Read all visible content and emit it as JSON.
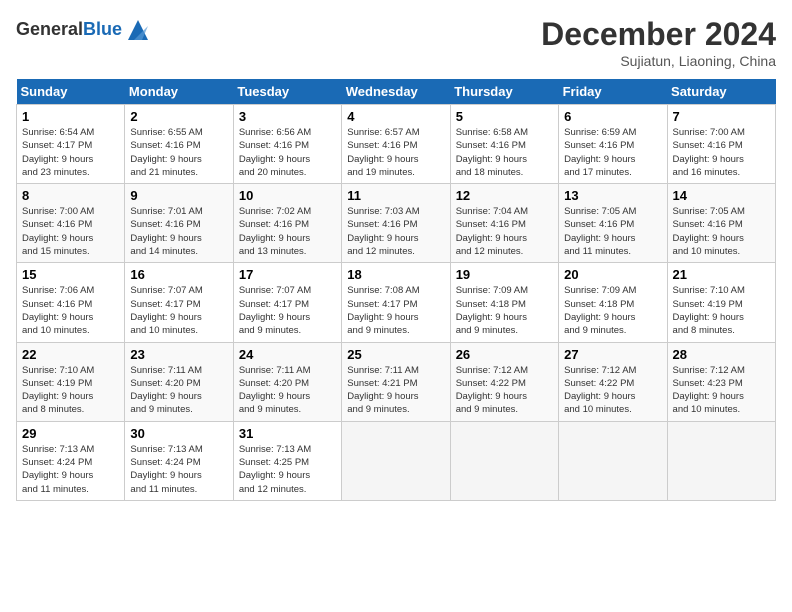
{
  "header": {
    "logo_line1": "General",
    "logo_line2": "Blue",
    "month_title": "December 2024",
    "subtitle": "Sujiatun, Liaoning, China"
  },
  "days_of_week": [
    "Sunday",
    "Monday",
    "Tuesday",
    "Wednesday",
    "Thursday",
    "Friday",
    "Saturday"
  ],
  "weeks": [
    [
      {
        "day": "1",
        "info": "Sunrise: 6:54 AM\nSunset: 4:17 PM\nDaylight: 9 hours\nand 23 minutes."
      },
      {
        "day": "2",
        "info": "Sunrise: 6:55 AM\nSunset: 4:16 PM\nDaylight: 9 hours\nand 21 minutes."
      },
      {
        "day": "3",
        "info": "Sunrise: 6:56 AM\nSunset: 4:16 PM\nDaylight: 9 hours\nand 20 minutes."
      },
      {
        "day": "4",
        "info": "Sunrise: 6:57 AM\nSunset: 4:16 PM\nDaylight: 9 hours\nand 19 minutes."
      },
      {
        "day": "5",
        "info": "Sunrise: 6:58 AM\nSunset: 4:16 PM\nDaylight: 9 hours\nand 18 minutes."
      },
      {
        "day": "6",
        "info": "Sunrise: 6:59 AM\nSunset: 4:16 PM\nDaylight: 9 hours\nand 17 minutes."
      },
      {
        "day": "7",
        "info": "Sunrise: 7:00 AM\nSunset: 4:16 PM\nDaylight: 9 hours\nand 16 minutes."
      }
    ],
    [
      {
        "day": "8",
        "info": "Sunrise: 7:00 AM\nSunset: 4:16 PM\nDaylight: 9 hours\nand 15 minutes."
      },
      {
        "day": "9",
        "info": "Sunrise: 7:01 AM\nSunset: 4:16 PM\nDaylight: 9 hours\nand 14 minutes."
      },
      {
        "day": "10",
        "info": "Sunrise: 7:02 AM\nSunset: 4:16 PM\nDaylight: 9 hours\nand 13 minutes."
      },
      {
        "day": "11",
        "info": "Sunrise: 7:03 AM\nSunset: 4:16 PM\nDaylight: 9 hours\nand 12 minutes."
      },
      {
        "day": "12",
        "info": "Sunrise: 7:04 AM\nSunset: 4:16 PM\nDaylight: 9 hours\nand 12 minutes."
      },
      {
        "day": "13",
        "info": "Sunrise: 7:05 AM\nSunset: 4:16 PM\nDaylight: 9 hours\nand 11 minutes."
      },
      {
        "day": "14",
        "info": "Sunrise: 7:05 AM\nSunset: 4:16 PM\nDaylight: 9 hours\nand 10 minutes."
      }
    ],
    [
      {
        "day": "15",
        "info": "Sunrise: 7:06 AM\nSunset: 4:16 PM\nDaylight: 9 hours\nand 10 minutes."
      },
      {
        "day": "16",
        "info": "Sunrise: 7:07 AM\nSunset: 4:17 PM\nDaylight: 9 hours\nand 10 minutes."
      },
      {
        "day": "17",
        "info": "Sunrise: 7:07 AM\nSunset: 4:17 PM\nDaylight: 9 hours\nand 9 minutes."
      },
      {
        "day": "18",
        "info": "Sunrise: 7:08 AM\nSunset: 4:17 PM\nDaylight: 9 hours\nand 9 minutes."
      },
      {
        "day": "19",
        "info": "Sunrise: 7:09 AM\nSunset: 4:18 PM\nDaylight: 9 hours\nand 9 minutes."
      },
      {
        "day": "20",
        "info": "Sunrise: 7:09 AM\nSunset: 4:18 PM\nDaylight: 9 hours\nand 9 minutes."
      },
      {
        "day": "21",
        "info": "Sunrise: 7:10 AM\nSunset: 4:19 PM\nDaylight: 9 hours\nand 8 minutes."
      }
    ],
    [
      {
        "day": "22",
        "info": "Sunrise: 7:10 AM\nSunset: 4:19 PM\nDaylight: 9 hours\nand 8 minutes."
      },
      {
        "day": "23",
        "info": "Sunrise: 7:11 AM\nSunset: 4:20 PM\nDaylight: 9 hours\nand 9 minutes."
      },
      {
        "day": "24",
        "info": "Sunrise: 7:11 AM\nSunset: 4:20 PM\nDaylight: 9 hours\nand 9 minutes."
      },
      {
        "day": "25",
        "info": "Sunrise: 7:11 AM\nSunset: 4:21 PM\nDaylight: 9 hours\nand 9 minutes."
      },
      {
        "day": "26",
        "info": "Sunrise: 7:12 AM\nSunset: 4:22 PM\nDaylight: 9 hours\nand 9 minutes."
      },
      {
        "day": "27",
        "info": "Sunrise: 7:12 AM\nSunset: 4:22 PM\nDaylight: 9 hours\nand 10 minutes."
      },
      {
        "day": "28",
        "info": "Sunrise: 7:12 AM\nSunset: 4:23 PM\nDaylight: 9 hours\nand 10 minutes."
      }
    ],
    [
      {
        "day": "29",
        "info": "Sunrise: 7:13 AM\nSunset: 4:24 PM\nDaylight: 9 hours\nand 11 minutes."
      },
      {
        "day": "30",
        "info": "Sunrise: 7:13 AM\nSunset: 4:24 PM\nDaylight: 9 hours\nand 11 minutes."
      },
      {
        "day": "31",
        "info": "Sunrise: 7:13 AM\nSunset: 4:25 PM\nDaylight: 9 hours\nand 12 minutes."
      },
      null,
      null,
      null,
      null
    ]
  ]
}
